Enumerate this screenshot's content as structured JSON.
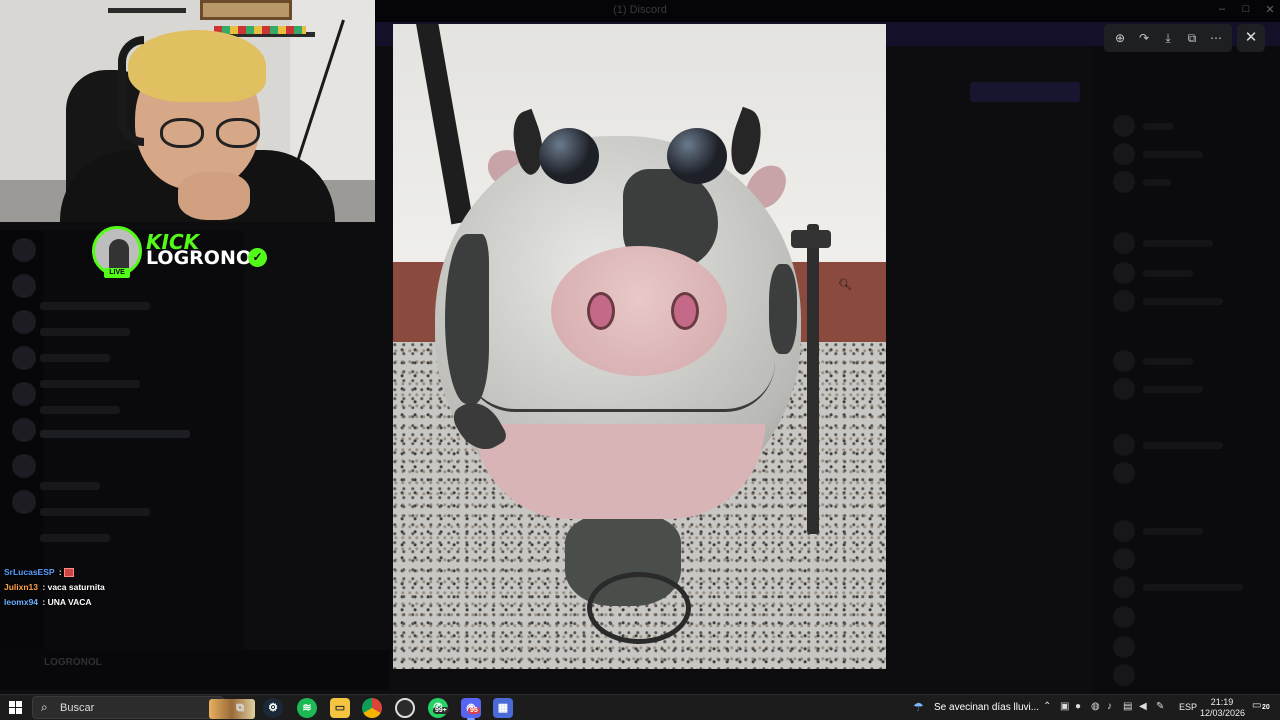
{
  "background_app": {
    "title": "(1) Discord",
    "user_name": "LOGRONOL"
  },
  "stream_overlay": {
    "platform_logo": "KICK",
    "channel_name": "LOGRONOL",
    "live_label": "LIVE",
    "verified_icon": "check-icon",
    "chat": [
      {
        "user": "SrLucasESP",
        "sep": " : ",
        "message": "",
        "user_color": "#5aa0ff",
        "emote": true
      },
      {
        "user": "Julixn13",
        "sep": " : ",
        "message": "vaca saturnita",
        "user_color": "#ffa040",
        "emote": false
      },
      {
        "user": "leomx94",
        "sep": " : ",
        "message": "UNA VACA",
        "user_color": "#6ab0ff",
        "emote": false
      }
    ],
    "accent_color": "#53fc18"
  },
  "image_viewer": {
    "toolbar": {
      "zoom": "zoom-icon",
      "forward": "forward-icon",
      "download": "download-icon",
      "open_external": "open-external-icon",
      "more": "more-icon"
    },
    "close": "close-icon",
    "image_subject": "cow-shaped-metal-trash-can-photo"
  },
  "taskbar": {
    "search_placeholder": "Buscar",
    "apps": [
      {
        "name": "task-view",
        "icon": "task-view-icon"
      },
      {
        "name": "steam",
        "icon": "steam-icon"
      },
      {
        "name": "spotify",
        "icon": "spotify-icon"
      },
      {
        "name": "file-explorer",
        "icon": "folder-icon"
      },
      {
        "name": "chrome",
        "icon": "chrome-icon"
      },
      {
        "name": "obs",
        "icon": "obs-icon"
      },
      {
        "name": "whatsapp",
        "icon": "whatsapp-icon",
        "badge": "99+"
      },
      {
        "name": "discord",
        "icon": "discord-icon",
        "badge": "95"
      },
      {
        "name": "calculator",
        "icon": "calculator-icon"
      }
    ],
    "weather": "Se avecinan días lluvi...",
    "language": "ESP",
    "time": "21:19",
    "date": "12/03/2026",
    "notification_count": "20"
  }
}
